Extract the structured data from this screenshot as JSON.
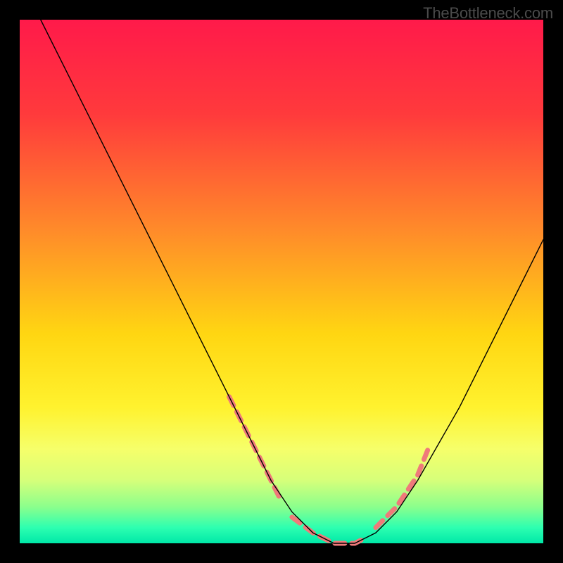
{
  "watermark": "TheBottleneck.com",
  "chart_data": {
    "type": "line",
    "title": "",
    "xlabel": "",
    "ylabel": "",
    "xlim": [
      0,
      100
    ],
    "ylim": [
      0,
      100
    ],
    "gradient_stops": [
      {
        "offset": 0,
        "color": "#ff1a4a"
      },
      {
        "offset": 18,
        "color": "#ff3a3c"
      },
      {
        "offset": 40,
        "color": "#ff8a2a"
      },
      {
        "offset": 60,
        "color": "#ffd612"
      },
      {
        "offset": 74,
        "color": "#fff22e"
      },
      {
        "offset": 82,
        "color": "#f6ff6a"
      },
      {
        "offset": 88,
        "color": "#d6ff7a"
      },
      {
        "offset": 93,
        "color": "#8cff8c"
      },
      {
        "offset": 97,
        "color": "#2dffb0"
      },
      {
        "offset": 100,
        "color": "#00e8a8"
      }
    ],
    "series": [
      {
        "name": "bottleneck-curve",
        "color": "#000000",
        "stroke_width": 1.4,
        "x": [
          4,
          8,
          12,
          16,
          20,
          24,
          28,
          32,
          36,
          40,
          44,
          48,
          52,
          56,
          60,
          64,
          68,
          72,
          76,
          80,
          84,
          88,
          92,
          96,
          100
        ],
        "y": [
          100,
          92,
          84,
          76,
          68,
          60,
          52,
          44,
          36,
          28,
          20,
          12,
          6,
          2,
          0,
          0,
          2,
          6,
          12,
          19,
          26,
          34,
          42,
          50,
          58
        ]
      }
    ],
    "highlight_segments": {
      "color": "#ef7a7a",
      "stroke_width": 7,
      "dash": [
        14,
        10
      ],
      "paths": [
        {
          "x": [
            40,
            44,
            48,
            50
          ],
          "y": [
            28,
            20,
            12,
            8
          ]
        },
        {
          "x": [
            52,
            56,
            60,
            64,
            66
          ],
          "y": [
            5,
            2,
            0,
            0,
            1
          ]
        },
        {
          "x": [
            68,
            72,
            76,
            78
          ],
          "y": [
            3,
            7,
            13,
            18
          ]
        }
      ]
    }
  }
}
